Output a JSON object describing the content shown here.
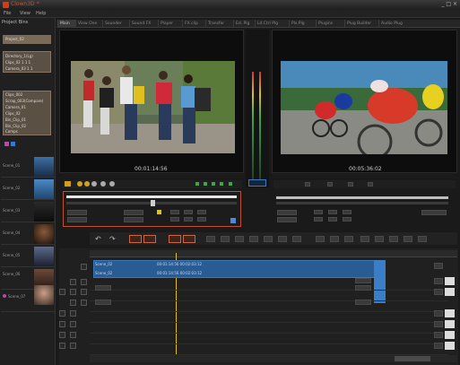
{
  "window": {
    "title": "Clown3D *",
    "controls": "_ □ ×"
  },
  "menu": [
    "File",
    "View",
    "Help"
  ],
  "tabs": [
    "Main",
    "View One",
    "Sounder",
    "Sound FX",
    "Player",
    "FX clip",
    "Transfer",
    "Ed. Plg",
    "Ld.Ctrl Plg",
    "Pls.Plg",
    "Plugins",
    "Plug Builder",
    "Audio Plug"
  ],
  "left_panel": {
    "title": "Project Bins",
    "selected_bin": "Project_02",
    "bin_group_1": [
      "Directory_1(Lg)",
      "Clips_02 1 1 1",
      "Camera_03 1 1"
    ],
    "bin_group_2": [
      "Clips_002",
      "Scrap_003(Compare)",
      "Camera_01",
      "Clips_02",
      "Bin_Clip_01",
      "Bin_Clip_02",
      "Comps"
    ],
    "thumbnails": [
      "Scene_01",
      "Scene_02",
      "Scene_03",
      "Scene_04",
      "Scene_05",
      "Scene_06",
      "Scene_07"
    ]
  },
  "source_viewer": {
    "timecode": "00:01:14:56"
  },
  "program_viewer": {
    "timecode": "00:05:36:02"
  },
  "colors": {
    "accent": "#c8401e",
    "clip_blue": "#2a5c94",
    "clip_light": "#3a7ec8",
    "meter_green": "#3aa845"
  }
}
